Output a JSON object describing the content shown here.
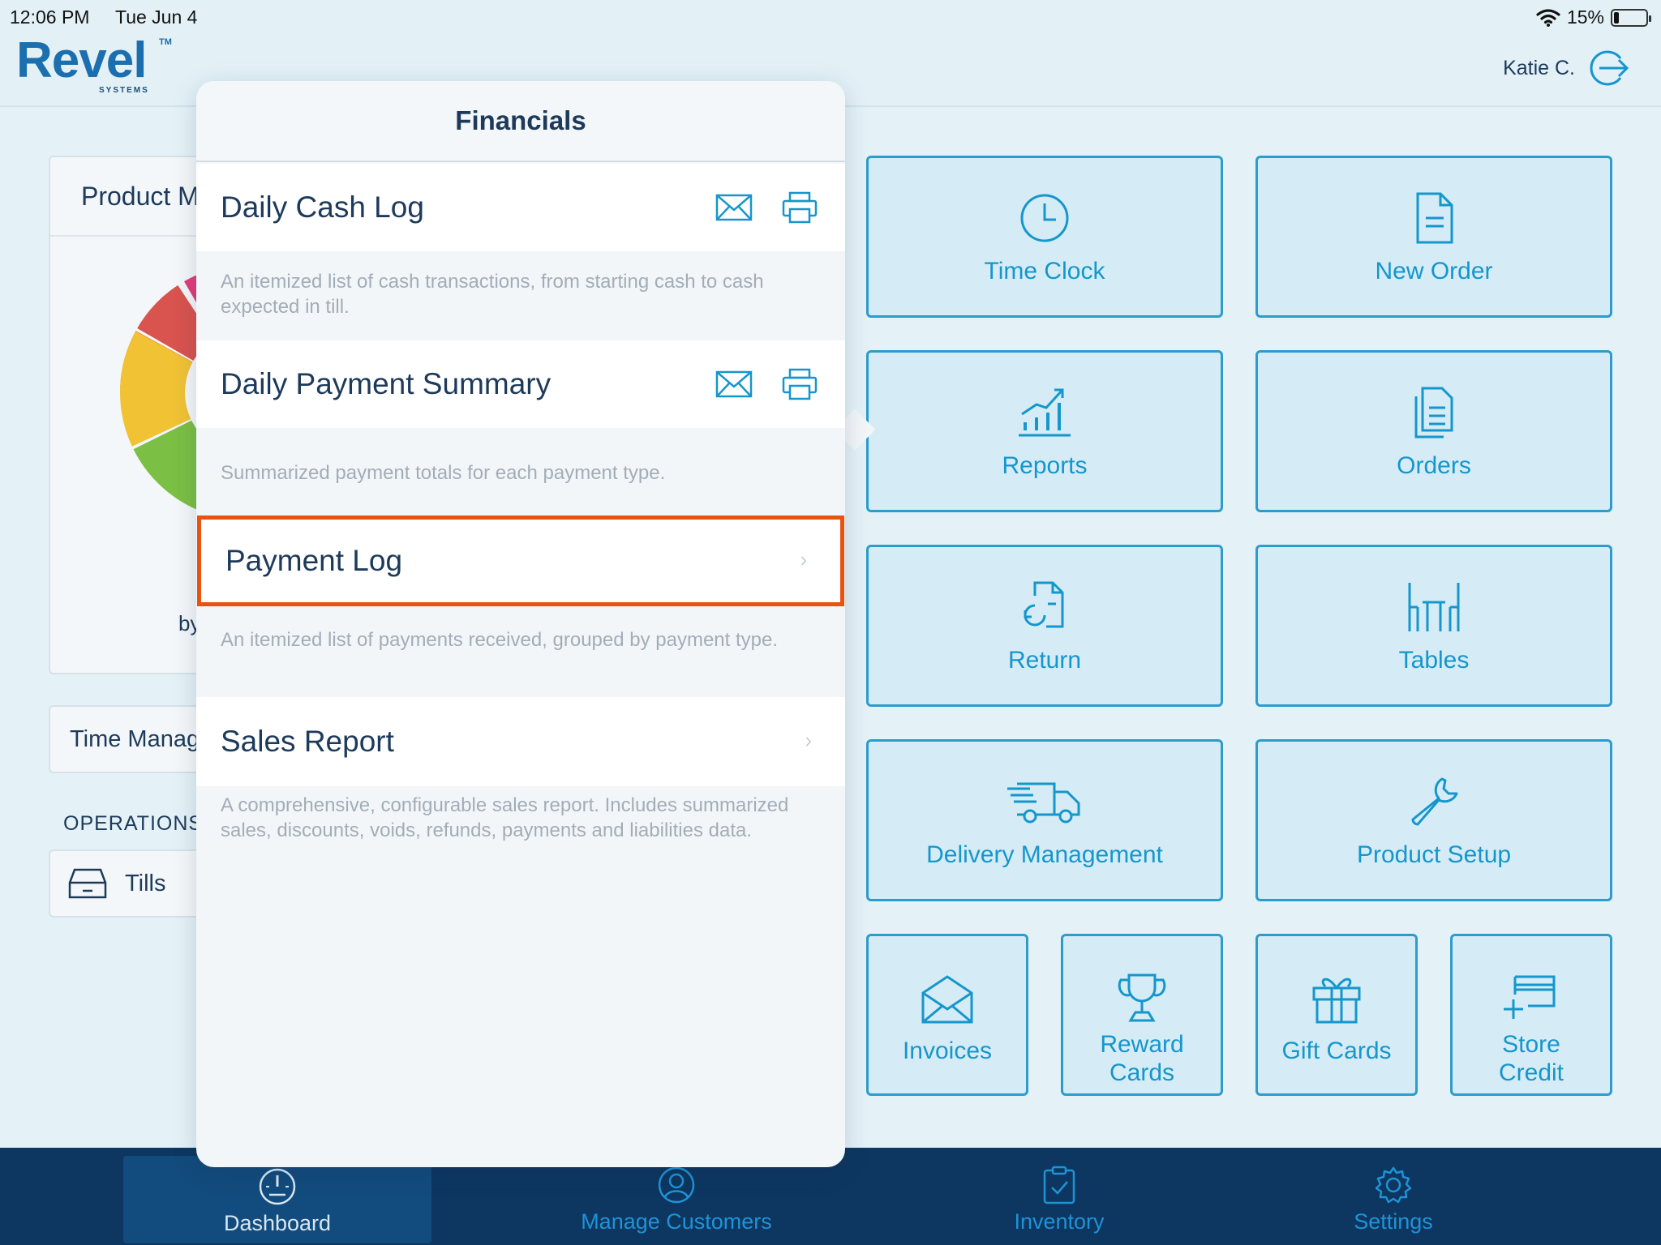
{
  "status": {
    "time": "12:06 PM",
    "date": "Tue Jun 4",
    "battery": "15%",
    "battery_level": 0.15
  },
  "brand": {
    "name": "Revel",
    "tm": "TM",
    "sub": "SYSTEMS"
  },
  "user": {
    "name": "Katie C."
  },
  "background": {
    "product_card_title": "Product M",
    "by_label": "by",
    "time_card": "Time Manag",
    "operations_label": "OPERATIONS",
    "tills_label": "Tills"
  },
  "popover": {
    "title": "Financials",
    "rows": [
      {
        "title": "Daily Cash Log",
        "description": "An itemized list of cash transactions, from starting cash to cash expected in till."
      },
      {
        "title": "Daily Payment Summary",
        "description": "Summarized payment totals for each payment type."
      },
      {
        "title": "Payment Log",
        "description": "An itemized list of payments received, grouped by payment type."
      },
      {
        "title": "Sales Report",
        "description": "A comprehensive, configurable sales report. Includes summarized sales, discounts, voids, refunds, payments and liabilities data."
      }
    ]
  },
  "tiles": {
    "time_clock": "Time Clock",
    "new_order": "New Order",
    "reports": "Reports",
    "orders": "Orders",
    "return": "Return",
    "tables": "Tables",
    "delivery": "Delivery Management",
    "product_setup": "Product Setup",
    "invoices": "Invoices",
    "reward_1": "Reward",
    "reward_2": "Cards",
    "gift_cards": "Gift Cards",
    "store_1": "Store",
    "store_2": "Credit"
  },
  "tabs": {
    "dashboard": "Dashboard",
    "customers": "Manage Customers",
    "inventory": "Inventory",
    "settings": "Settings"
  },
  "colors": {
    "accent": "#1596cc",
    "tabbar": "#0d3660",
    "highlight": "#e8530f",
    "brand": "#1b6fae"
  }
}
